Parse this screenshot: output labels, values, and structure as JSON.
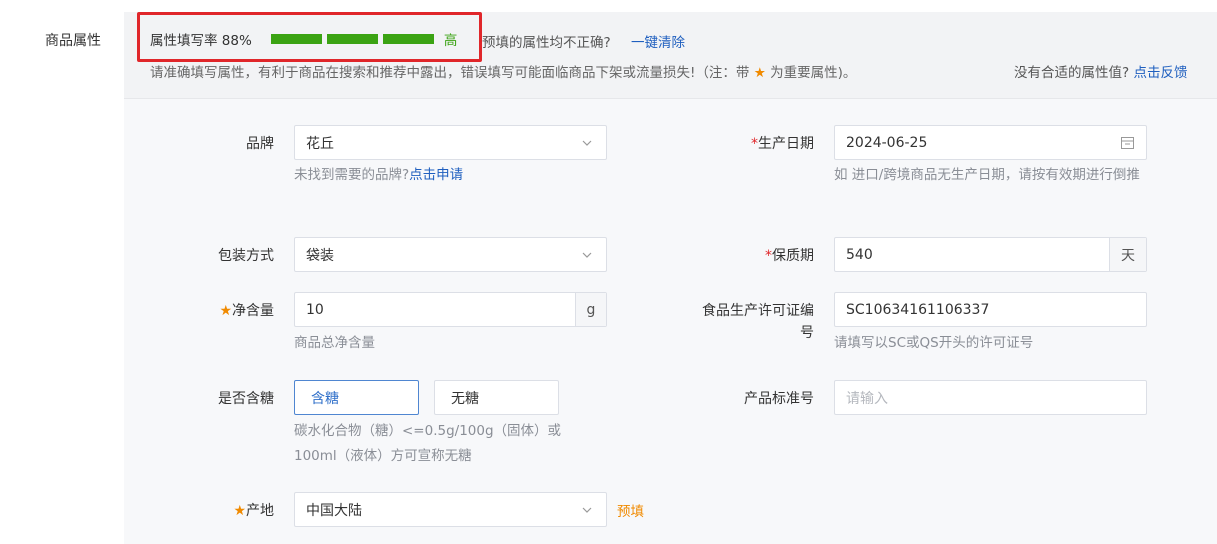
{
  "section_label": "商品属性",
  "fill_rate": {
    "text": "属性填写率 88%",
    "value_percent": 88,
    "segments_filled": 3,
    "segments_total": 3,
    "level": "高",
    "bar_color": "#3ba313"
  },
  "prefill_question": "预填的属性均不正确?",
  "clear_link": "一键清除",
  "notice": {
    "prefix": "请准确填写属性，有利于商品在搜索和推荐中露出，错误填写可能面临商品下架或流量损失!（注：带",
    "star": "★",
    "suffix": "为重要属性)。"
  },
  "feedback": {
    "question": "没有合适的属性值?",
    "link": "点击反馈"
  },
  "fields": {
    "brand": {
      "label": "品牌",
      "value": "花丘",
      "hint": "未找到需要的品牌?",
      "hint_link": "点击申请"
    },
    "production_date": {
      "required_mark": "*",
      "label": "生产日期",
      "value": "2024-06-25",
      "hint": "如 进口/跨境商品无生产日期，请按有效期进行倒推"
    },
    "packaging": {
      "label": "包装方式",
      "value": "袋装"
    },
    "shelf_life": {
      "required_mark": "*",
      "label": "保质期",
      "value": "540",
      "unit": "天"
    },
    "net_content": {
      "star": "★",
      "label": "净含量",
      "value": "10",
      "unit": "g",
      "hint": "商品总净含量"
    },
    "license": {
      "label_line1": "食品生产许可证编",
      "label_line2": "号",
      "value": "SC10634161106337",
      "hint": "请填写以SC或QS开头的许可证号"
    },
    "sugar": {
      "label": "是否含糖",
      "options": [
        "含糖",
        "无糖"
      ],
      "selected": "含糖",
      "hint_line1": "碳水化合物（糖）<=0.5g/100g（固体）或",
      "hint_line2": "100ml（液体）方可宣称无糖"
    },
    "standard": {
      "label": "产品标准号",
      "placeholder": "请输入"
    },
    "origin": {
      "star": "★",
      "label": "产地",
      "value": "中国大陆",
      "prefill_tag": "预填"
    }
  }
}
